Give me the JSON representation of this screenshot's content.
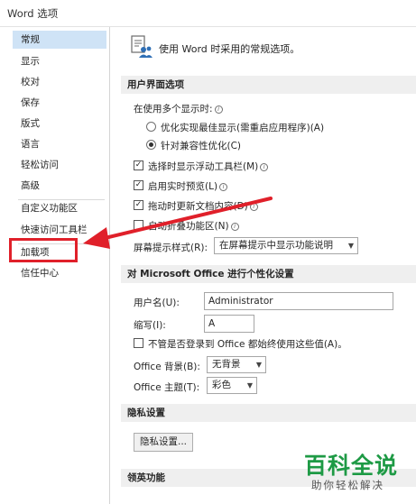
{
  "window": {
    "title": "Word 选项"
  },
  "sidebar": {
    "items": [
      {
        "label": "常规",
        "selected": true
      },
      {
        "label": "显示"
      },
      {
        "label": "校对"
      },
      {
        "label": "保存"
      },
      {
        "label": "版式"
      },
      {
        "label": "语言"
      },
      {
        "label": "轻松访问"
      },
      {
        "label": "高级"
      },
      {
        "label": "自定义功能区"
      },
      {
        "label": "快速访问工具栏"
      },
      {
        "label": "加载项",
        "highlighted": true
      },
      {
        "label": "信任中心"
      }
    ]
  },
  "general": {
    "header": "使用 Word 时采用的常规选项。",
    "ui_section": {
      "title": "用户界面选项",
      "multi_display_label": "在使用多个显示时:",
      "radio_optimize": "优化实现最佳显示(需重启应用程序)(A)",
      "radio_compat": "针对兼容性优化(C)",
      "check_mini_toolbar": "选择时显示浮动工具栏(M)",
      "check_live_preview": "启用实时预览(L)",
      "check_update_drag": "拖动时更新文档内容(D)",
      "check_collapse_ribbon": "自动折叠功能区(N)",
      "screentip_label": "屏幕提示样式(R):",
      "screentip_value": "在屏幕提示中显示功能说明"
    },
    "personalize_section": {
      "title": "对 Microsoft Office 进行个性化设置",
      "username_label": "用户名(U):",
      "username_value": "Administrator",
      "initials_label": "缩写(I):",
      "initials_value": "A",
      "always_use_label": "不管是否登录到 Office 都始终使用这些值(A)。",
      "background_label": "Office 背景(B):",
      "background_value": "无背景",
      "theme_label": "Office 主题(T):",
      "theme_value": "彩色"
    },
    "privacy_section": {
      "title": "隐私设置",
      "button_label": "隐私设置..."
    },
    "linkedin_section": {
      "title": "领英功能"
    }
  },
  "watermark": {
    "title": "百科全说",
    "subtitle": "助你轻松解决"
  },
  "colors": {
    "annotation_red": "#e0202a",
    "selected_bg": "#cfe3f6",
    "watermark_green": "#1e9a45"
  }
}
